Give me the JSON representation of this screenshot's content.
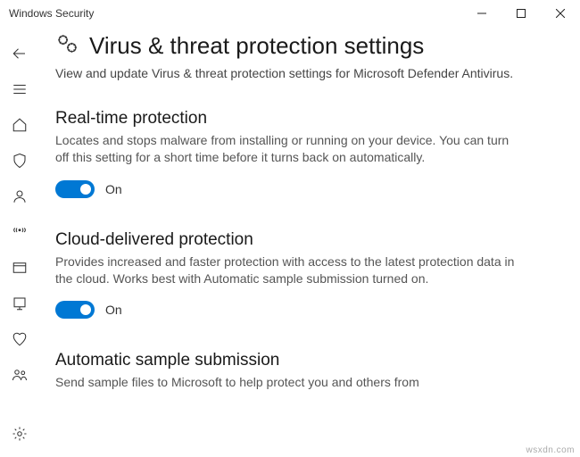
{
  "window": {
    "title": "Windows Security"
  },
  "page": {
    "title": "Virus & threat protection settings",
    "description": "View and update Virus & threat protection settings for Microsoft Defender Antivirus."
  },
  "sections": {
    "realtime": {
      "title": "Real-time protection",
      "desc": "Locates and stops malware from installing or running on your device. You can turn off this setting for a short time before it turns back on automatically.",
      "toggle_label": "On"
    },
    "cloud": {
      "title": "Cloud-delivered protection",
      "desc": "Provides increased and faster protection with access to the latest protection data in the cloud. Works best with Automatic sample submission turned on.",
      "toggle_label": "On"
    },
    "auto_sample": {
      "title": "Automatic sample submission",
      "desc": "Send sample files to Microsoft to help protect you and others from"
    }
  },
  "watermark": "wsxdn.com"
}
